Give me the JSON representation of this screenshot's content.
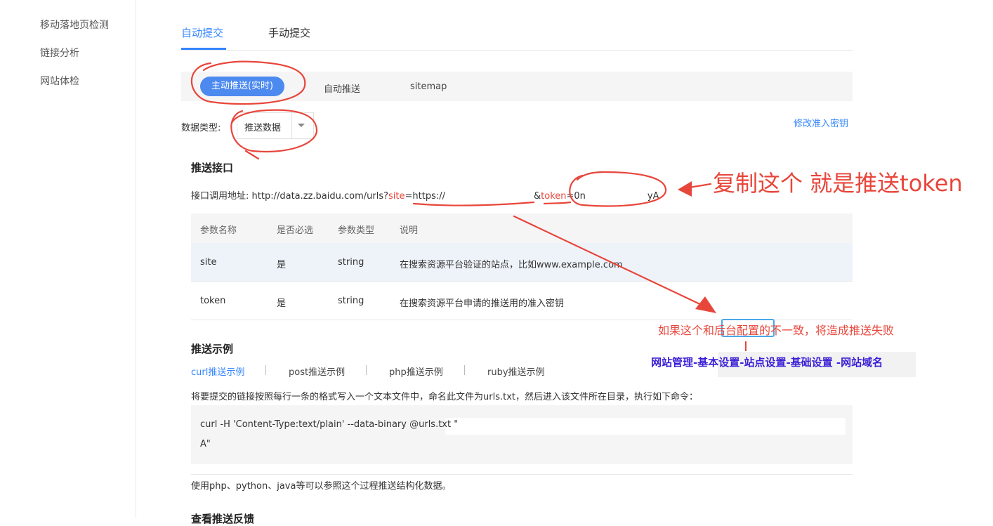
{
  "sidebar": {
    "items": [
      {
        "label": "移动落地页检测"
      },
      {
        "label": "链接分析"
      },
      {
        "label": "网站体检"
      }
    ]
  },
  "tabs": {
    "auto": "自动提交",
    "manual": "手动提交"
  },
  "subtabs": {
    "active": "主动推送(实时)",
    "auto_push": "自动推送",
    "sitemap": "sitemap"
  },
  "data_type": {
    "label": "数据类型:",
    "value": "推送数据"
  },
  "modify_key_link": "修改准入密钥",
  "push_api": {
    "title": "推送接口",
    "label": "接口调用地址:",
    "url_prefix": "http://data.zz.baidu.com/urls?",
    "site_param": "site",
    "site_value": "=https://",
    "amp": "&",
    "token_param": "token",
    "token_value_start": "=0n",
    "token_value_end": "yA"
  },
  "params_table": {
    "headers": [
      "参数名称",
      "是否必选",
      "参数类型",
      "说明"
    ],
    "rows": [
      [
        "site",
        "是",
        "string",
        "在搜索资源平台验证的站点，比如www.example.com"
      ],
      [
        "token",
        "是",
        "string",
        "在搜索资源平台申请的推送用的准入密钥"
      ]
    ]
  },
  "example": {
    "title": "推送示例",
    "tabs": [
      "curl推送示例",
      "post推送示例",
      "php推送示例",
      "ruby推送示例"
    ],
    "instruction": "将要提交的链接按照每行一条的格式写入一个文本文件中，命名此文件为urls.txt，然后进入该文件所在目录，执行如下命令：",
    "code_line1": "curl -H 'Content-Type:text/plain' --data-binary @urls.txt \"",
    "code_line2": "A\"",
    "footnote": "使用php、python、java等可以参照这个过程推送结构化数据。"
  },
  "next_section_title": "查看推送反馈",
  "annotations": {
    "copy_note": "复制这个 就是推送token",
    "mismatch_note": "如果这个和后台配置的不一致，将造成推送失败",
    "path_note": "网站管理-基本设置-站点设置-基础设置 -网站域名"
  },
  "colors": {
    "accent": "#3385ff",
    "annotation_red": "#e8463b",
    "annotation_blue": "#3a1fd6"
  }
}
